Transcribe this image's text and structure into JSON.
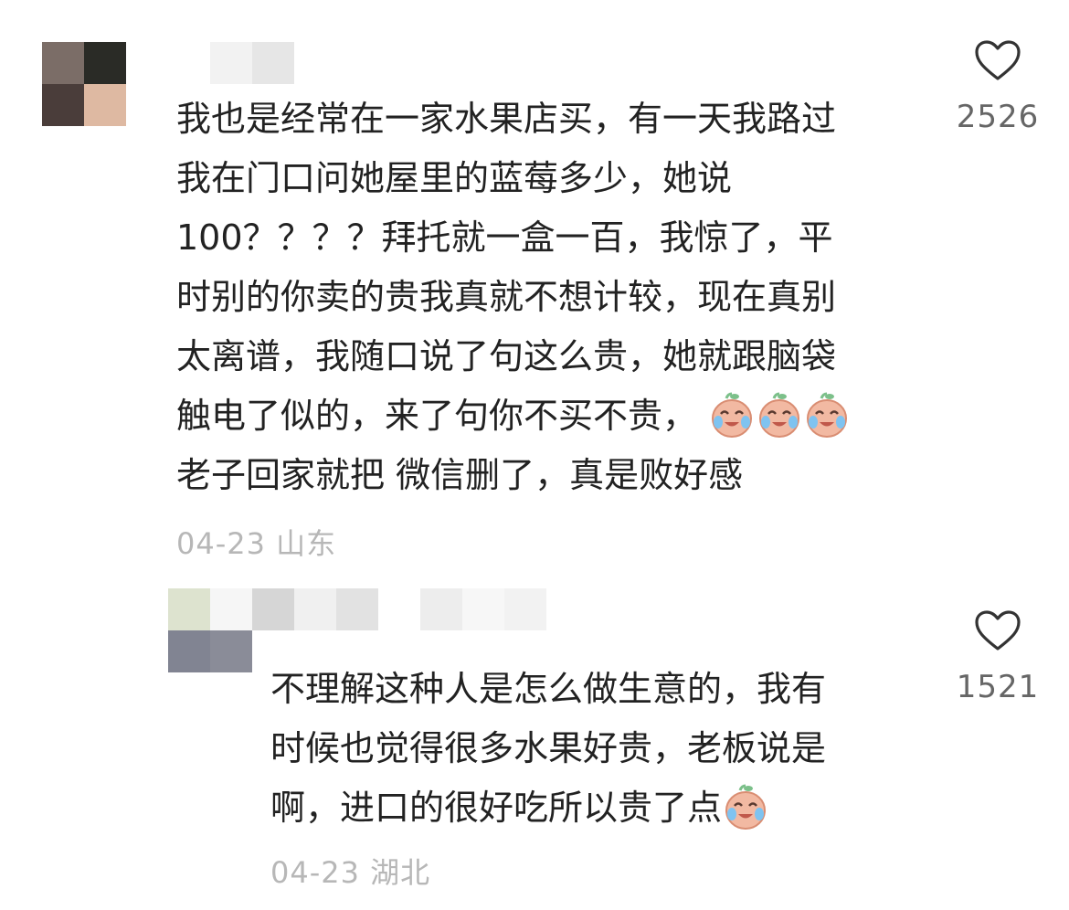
{
  "comments": [
    {
      "avatar": {
        "pixels": [
          "#7b6d67",
          "#2a2b26",
          "#4a3d3a",
          "#deb9a2"
        ]
      },
      "username_mosaic": [
        "#f2f2f2",
        "#e6e6e6"
      ],
      "line1": "我也是经常在一家水果店买，有一天我路过",
      "line2": "我在门口问她屋里的蓝莓多少，她说",
      "line3": "100？？？？拜托就一盒一百，我惊了，平",
      "line4": "时别的你卖的贵我真就不想计较，现在真别",
      "line5": "太离谱，我随口说了句这么贵，她就跟脑袋",
      "line6": "触电了似的，来了句你不买不贵，",
      "line6_emojis": [
        "laughing-crying-face-icon",
        "laughing-crying-face-icon",
        "laughing-crying-face-icon"
      ],
      "line7": "老子回家就把 微信删了，真是败好感",
      "date": "04-23",
      "location": "山东",
      "likes": "2526"
    },
    {
      "avatar": {
        "pixels": [
          "#dde3cf",
          "#f6f6f6",
          "#818492",
          "#8a8c98"
        ]
      },
      "username_mosaic": [
        "#d6d6d6",
        "#f0f0f0",
        "#e2e2e2",
        "#ffffff",
        "#ededed",
        "#f7f7f7",
        "#f2f2f2"
      ],
      "line1": "不理解这种人是怎么做生意的，我有",
      "line2": "时候也觉得很多水果好贵，老板说是",
      "line3": "啊，进口的很好吃所以贵了点",
      "line3_emojis": [
        "laughing-crying-face-icon"
      ],
      "date": "04-23",
      "location": "湖北",
      "likes": "1521"
    }
  ],
  "colors": {
    "text": "#222222",
    "meta": "#b7b7b7",
    "like_count": "#666666",
    "heart_outline": "#333333",
    "emoji_face": "#f2b9a2",
    "emoji_tear": "#7fc3f0",
    "emoji_leaf": "#7cc08a"
  }
}
